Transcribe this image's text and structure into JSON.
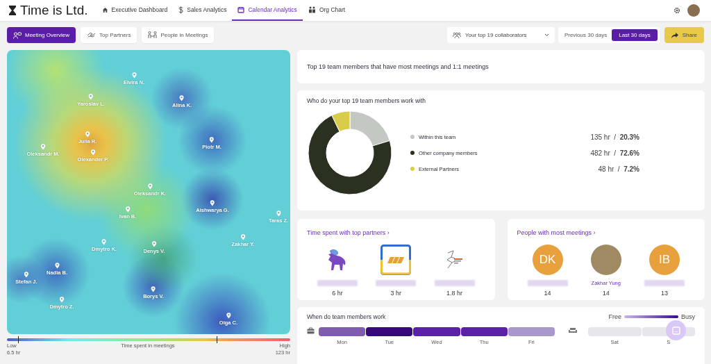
{
  "nav": {
    "logo": "Time is Ltd.",
    "items": [
      {
        "label": "Executive Dashboard",
        "selected": false
      },
      {
        "label": "Sales Analytics",
        "selected": false
      },
      {
        "label": "Calendar Analytics",
        "selected": true
      },
      {
        "label": "Org Chart",
        "selected": false
      }
    ]
  },
  "view_tabs": [
    {
      "label": "Meeting Overview",
      "selected": true
    },
    {
      "label": "Top Partners",
      "selected": false
    },
    {
      "label": "People in Meetings",
      "selected": false
    }
  ],
  "collaborators_dropdown": {
    "value": "Your top 19 collaborators"
  },
  "period": [
    {
      "label": "Previous 30 days",
      "selected": false
    },
    {
      "label": "Last 30 days",
      "selected": true
    }
  ],
  "share_button": "Share",
  "map": {
    "people": [
      "Elvira N.",
      "Yaroslav L.",
      "Alina K.",
      "Julia R.",
      "Olexander P.",
      "Oleksandr M.",
      "Piotr M.",
      "Oleksandr K.",
      "Aishwarya G.",
      "Ivan B.",
      "Taras Z.",
      "Zakhar Y.",
      "Dmytro K.",
      "Denys V.",
      "Nadia B.",
      "Stefan J.",
      "Dmytro Z.",
      "Borys V.",
      "Olga C."
    ],
    "legend": {
      "title": "Time spent in meetings",
      "low_label": "Low",
      "low_value": "6.5 hr",
      "high_label": "High",
      "high_value": "123 hr"
    }
  },
  "summary": "Top 19 team members that have most meetings and 1:1 meetings",
  "collaboration": {
    "title": "Who do your top 19 team members work with",
    "chart_data": {
      "type": "donut",
      "categories": [
        "Within this team",
        "Other company members",
        "External Partners"
      ],
      "values": [
        20.3,
        72.6,
        7.2
      ]
    },
    "rows": [
      {
        "color": "#c4c8c2",
        "value": "135 hr  /  **20.3%**"
      },
      {
        "color": "#2b3120",
        "value": "482 hr  /  **72.6%**"
      },
      {
        "color": "#d8cc4a",
        "value": "48 hr  /  **7.2%**"
      }
    ]
  },
  "partners": {
    "title": "Time spent with top partners ›",
    "items": [
      {
        "kind": "animal",
        "hours": "6 hr"
      },
      {
        "kind": "square",
        "hours": "3 hr"
      },
      {
        "kind": "lines",
        "hours": "1.8 hr"
      }
    ]
  },
  "people_meetings": {
    "title": "People with most meetings ›",
    "items": [
      {
        "kind": "initials",
        "initials": "DK",
        "count": "14"
      },
      {
        "kind": "photo",
        "name": "Zakhar Yung",
        "count": "14"
      },
      {
        "kind": "initials",
        "initials": "IB",
        "count": "13"
      }
    ]
  },
  "work_week": {
    "title": "When do team members work",
    "legend_free": "Free",
    "legend_busy": "Busy",
    "workdays": [
      {
        "day": "Mon",
        "color": "#7f5cb0"
      },
      {
        "day": "Tue",
        "color": "#38087a"
      },
      {
        "day": "Wed",
        "color": "#5a20a6"
      },
      {
        "day": "Thu",
        "color": "#5a20a6"
      },
      {
        "day": "Fri",
        "color": "#a898cc"
      }
    ],
    "weekend": [
      {
        "day": "Sat",
        "color": "#e6e6ec"
      },
      {
        "day": "S",
        "color": "#e6e6ec"
      }
    ]
  }
}
